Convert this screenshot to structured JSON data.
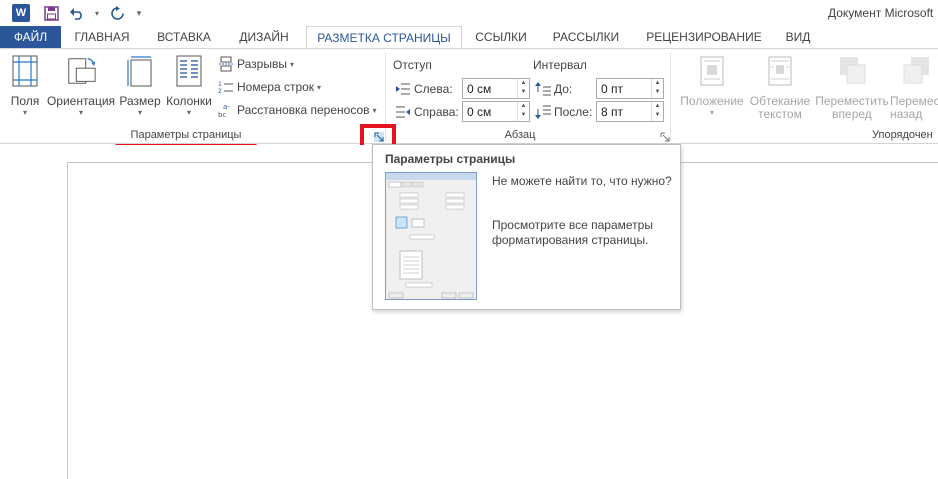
{
  "window": {
    "title": "Документ Microsoft",
    "app_icon": "word-icon"
  },
  "quick_access": [
    "save-icon",
    "undo-icon",
    "redo-icon",
    "customize-icon"
  ],
  "tabs": [
    {
      "label": "ФАЙЛ"
    },
    {
      "label": "ГЛАВНАЯ"
    },
    {
      "label": "ВСТАВКА"
    },
    {
      "label": "ДИЗАЙН"
    },
    {
      "label": "РАЗМЕТКА СТРАНИЦЫ"
    },
    {
      "label": "ССЫЛКИ"
    },
    {
      "label": "РАССЫЛКИ"
    },
    {
      "label": "РЕЦЕНЗИРОВАНИЕ"
    },
    {
      "label": "ВИД"
    }
  ],
  "page_setup": {
    "label": "Параметры страницы",
    "margins": "Поля",
    "orientation": "Ориентация",
    "size": "Размер",
    "columns": "Колонки",
    "breaks": "Разрывы",
    "line_numbers": "Номера строк",
    "hyphenation": "Расстановка переносов"
  },
  "paragraph": {
    "label": "Абзац",
    "indent_header": "Отступ",
    "spacing_header": "Интервал",
    "left_label": "Слева:",
    "left_value": "0 см",
    "right_label": "Справа:",
    "right_value": "0 см",
    "before_label": "До:",
    "before_value": "0 пт",
    "after_label": "После:",
    "after_value": "8 пт"
  },
  "arrange": {
    "label": "Упорядочен",
    "position": "Положение",
    "wrap_line1": "Обтекание",
    "wrap_line2": "текстом",
    "forward_line1": "Переместить",
    "forward_line2": "вперед",
    "backward_line1": "Перемест",
    "backward_line2": "назад"
  },
  "tooltip": {
    "title": "Параметры страницы",
    "line1": "Не можете найти то, что нужно?",
    "line2": "Просмотрите все параметры форматирования страницы."
  },
  "colors": {
    "accent": "#2b579a",
    "highlight": "#e3141c"
  }
}
